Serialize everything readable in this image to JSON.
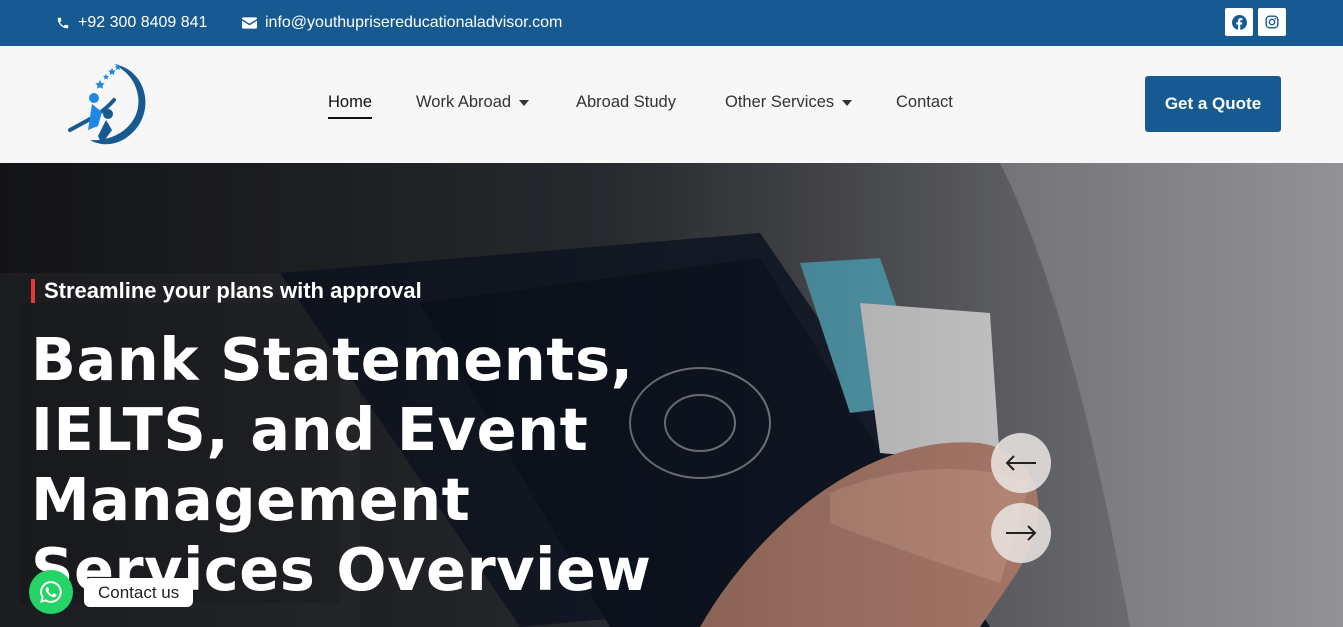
{
  "topbar": {
    "phone": "+92 300 8409 841",
    "email": "info@youthuprisereducationaladvisor.com",
    "phone_icon": "phone-icon",
    "email_icon": "envelope-icon",
    "social": [
      "facebook-icon",
      "instagram-icon"
    ],
    "background": "#175a92"
  },
  "nav": {
    "items": [
      {
        "label": "Home",
        "active": true
      },
      {
        "label": "Work Abroad",
        "dropdown": true
      },
      {
        "label": "Abroad Study"
      },
      {
        "label": "Other Services",
        "dropdown": true
      },
      {
        "label": "Contact"
      }
    ],
    "cta": "Get a Quote"
  },
  "hero": {
    "eyebrow": "Streamline your plans with approval",
    "headline": "Bank Statements, IELTS, and Event Management Services Overview",
    "prev_icon": "arrow-left-icon",
    "next_icon": "arrow-right-icon",
    "accent": "#e53935"
  },
  "floating": {
    "whatsapp_icon": "whatsapp-icon",
    "label": "Contact us",
    "color": "#25d366"
  }
}
